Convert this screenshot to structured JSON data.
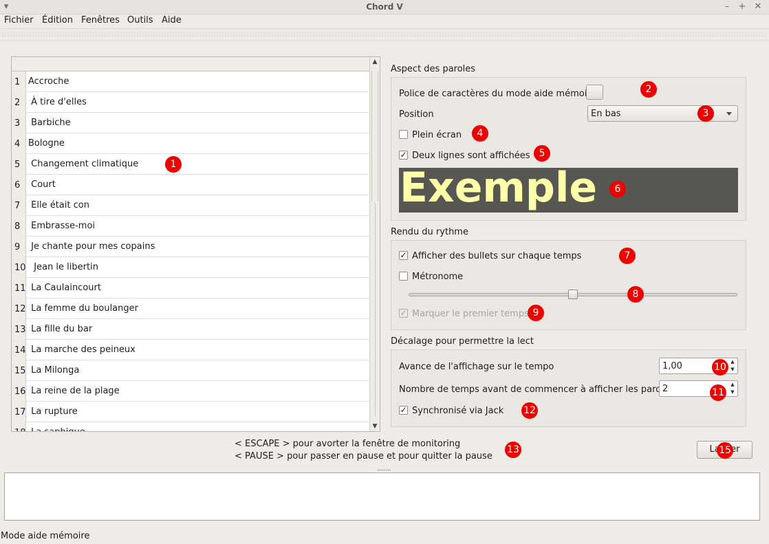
{
  "window": {
    "title": "Chord V",
    "menu_icon": "chevron-down-icon",
    "minimize": "–",
    "maximize": "+",
    "close": "✕"
  },
  "menu": [
    "Fichier",
    "Édition",
    "Fenêtres",
    "Outils",
    "Aide"
  ],
  "songs": [
    {
      "n": "1",
      "t": "Accroche"
    },
    {
      "n": "2",
      "t": " À tire d'elles"
    },
    {
      "n": "3",
      "t": " Barbiche"
    },
    {
      "n": "4",
      "t": "Bologne"
    },
    {
      "n": "5",
      "t": " Changement climatique"
    },
    {
      "n": "6",
      "t": " Court"
    },
    {
      "n": "7",
      "t": " Elle était con"
    },
    {
      "n": "8",
      "t": " Embrasse-moi"
    },
    {
      "n": "9",
      "t": " Je chante pour mes copains"
    },
    {
      "n": "10",
      "t": "  Jean le libertin"
    },
    {
      "n": "11",
      "t": " La Caulaincourt"
    },
    {
      "n": "12",
      "t": " La femme du boulanger"
    },
    {
      "n": "13",
      "t": " La fille du bar"
    },
    {
      "n": "14",
      "t": " La marche des peineux"
    },
    {
      "n": "15",
      "t": " La Milonga"
    },
    {
      "n": "16",
      "t": " La reine de la plage"
    },
    {
      "n": "17",
      "t": " La rupture"
    },
    {
      "n": "18",
      "t": " La saphique"
    }
  ],
  "lyrics": {
    "group_title": "Aspect des paroles",
    "font_label": "Police de caractères du mode aide mémoire",
    "position_label": "Position",
    "position_value": "En bas",
    "fullscreen_label": "Plein écran",
    "fullscreen_checked": false,
    "two_lines_label": "Deux lignes sont affichées",
    "two_lines_checked": true,
    "preview_text": "Exemple"
  },
  "rhythm": {
    "group_title": "Rendu du rythme",
    "bullets_label": "Afficher des bullets sur chaque temps",
    "bullets_checked": true,
    "metronome_label": "Métronome",
    "metronome_checked": false,
    "slider_value_fraction": 0.5,
    "first_beat_label": "Marquer le premier temps",
    "first_beat_checked": true,
    "first_beat_enabled": false
  },
  "offset": {
    "group_title": "Décalage pour permettre la lecture",
    "advance_label": "Avance de l'affichage sur le tempo",
    "advance_value": "1,00",
    "beats_label": "Nombre de temps avant de commencer à afficher les paroles",
    "beats_value": "2",
    "jack_label": "Synchronisé via Jack",
    "jack_checked": true
  },
  "hints": {
    "escape": "< ESCAPE > pour avorter la fenêtre de monitoring",
    "pause": "< PAUSE > pour passer en pause et pour quitter la pause"
  },
  "launch_button": "Lancer",
  "status": "Mode aide mémoire",
  "markers": [
    "1",
    "2",
    "3",
    "4",
    "5",
    "6",
    "7",
    "8",
    "9",
    "10",
    "11",
    "12",
    "13",
    "15"
  ],
  "colors": {
    "marker": "#ee0000",
    "preview_bg": "#565652",
    "preview_text": "#ffffaa"
  }
}
